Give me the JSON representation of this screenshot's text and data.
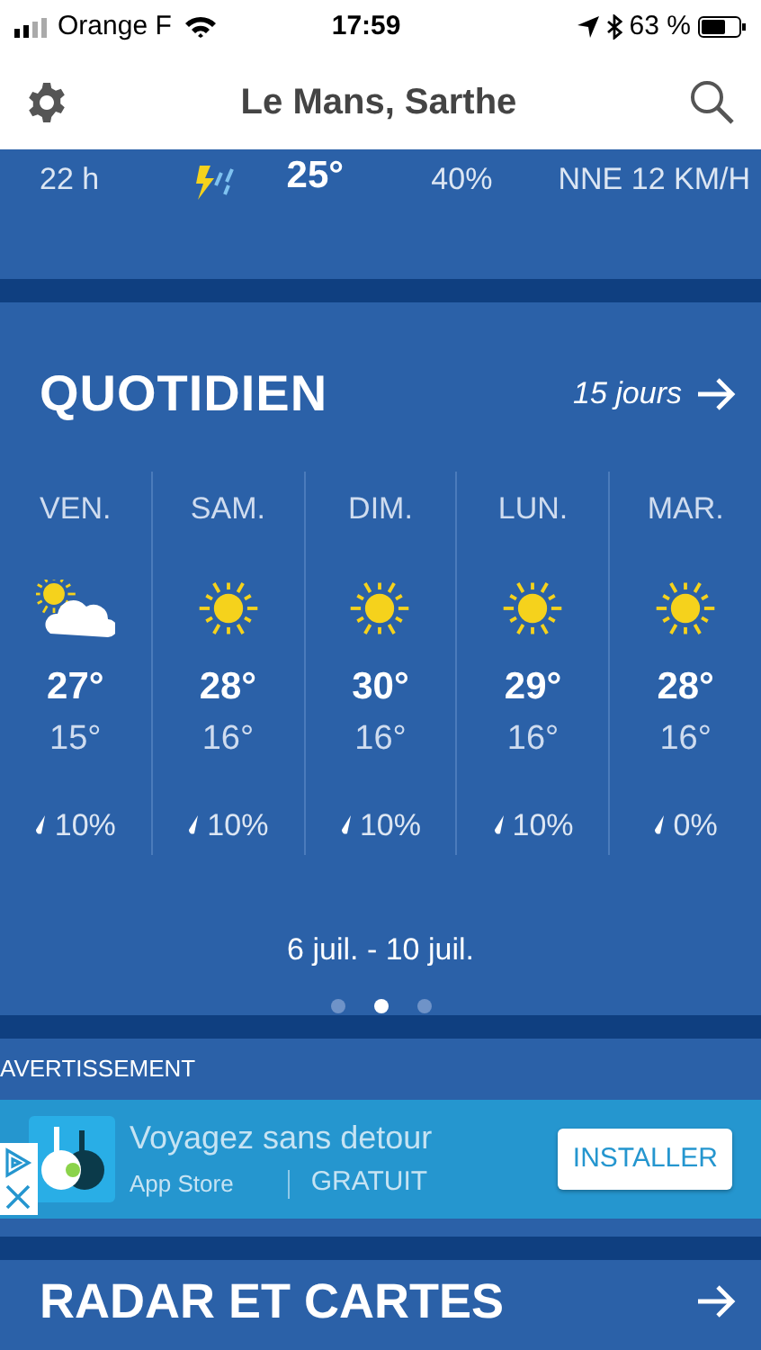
{
  "status_bar": {
    "carrier": "Orange F",
    "time": "17:59",
    "battery": "63 %"
  },
  "header": {
    "title": "Le Mans, Sarthe"
  },
  "hourly_row": {
    "hour": "22 h",
    "kind": "storm",
    "temp": "25°",
    "humidity": "40%",
    "wind": "NNE 12 KM/H"
  },
  "daily": {
    "title": "QUOTIDIEN",
    "more_link": "15 jours",
    "days": [
      {
        "day": "VEN.",
        "kind": "partly_cloudy",
        "high": "27°",
        "low": "15°",
        "precip": "10%"
      },
      {
        "day": "SAM.",
        "kind": "sun",
        "high": "28°",
        "low": "16°",
        "precip": "10%"
      },
      {
        "day": "DIM.",
        "kind": "sun",
        "high": "30°",
        "low": "16°",
        "precip": "10%"
      },
      {
        "day": "LUN.",
        "kind": "sun",
        "high": "29°",
        "low": "16°",
        "precip": "10%"
      },
      {
        "day": "MAR.",
        "kind": "sun",
        "high": "28°",
        "low": "16°",
        "precip": "0%"
      }
    ],
    "date_range": "6 juil. - 10 juil.",
    "pages": [
      {
        "selected": false
      },
      {
        "selected": true
      },
      {
        "selected": false
      }
    ]
  },
  "ad": {
    "label": "AVERTISSEMENT",
    "title": "Voyagez sans detour",
    "store": "App Store",
    "price": "GRATUIT",
    "button": "INSTALLER"
  },
  "radar": {
    "title": "RADAR ET CARTES"
  }
}
